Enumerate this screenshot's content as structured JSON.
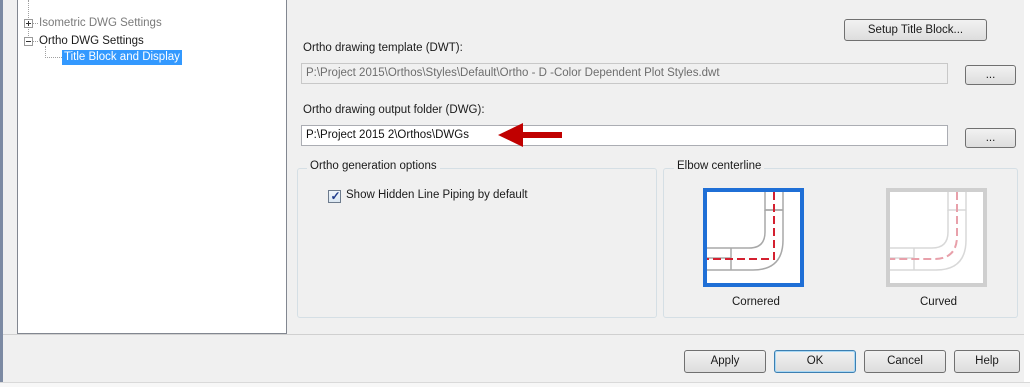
{
  "tree": {
    "items": [
      {
        "label": "Isometric DWG Settings",
        "state": "collapsed"
      },
      {
        "label": "Ortho DWG Settings",
        "state": "expanded"
      },
      {
        "label": "Title Block and Display",
        "state": "selected"
      }
    ]
  },
  "buttons": {
    "setup_title_block": "Setup Title Block...",
    "browse_template": "...",
    "browse_output": "...",
    "apply": "Apply",
    "ok": "OK",
    "cancel": "Cancel",
    "help": "Help"
  },
  "template": {
    "label": "Ortho drawing template (DWT):",
    "value": "P:\\Project 2015\\Orthos\\Styles\\Default\\Ortho - D -Color Dependent Plot Styles.dwt"
  },
  "output": {
    "label": "Ortho drawing output folder (DWG):",
    "value": "P:\\Project 2015 2\\Orthos\\DWGs"
  },
  "generation": {
    "group_title": "Ortho generation options",
    "checkbox_label": "Show Hidden Line Piping by default",
    "checked": true
  },
  "elbow": {
    "group_title": "Elbow centerline",
    "options": [
      {
        "label": "Cornered",
        "selected": true
      },
      {
        "label": "Curved",
        "selected": false
      }
    ]
  },
  "colors": {
    "selection": "#3399ff",
    "tile_selected_border": "#1f6fd6",
    "annotation_arrow": "#c00000",
    "centerline": "#d42030"
  },
  "icons": {
    "annotation": "red-arrow-icon",
    "checkbox": "checkmark-icon"
  }
}
